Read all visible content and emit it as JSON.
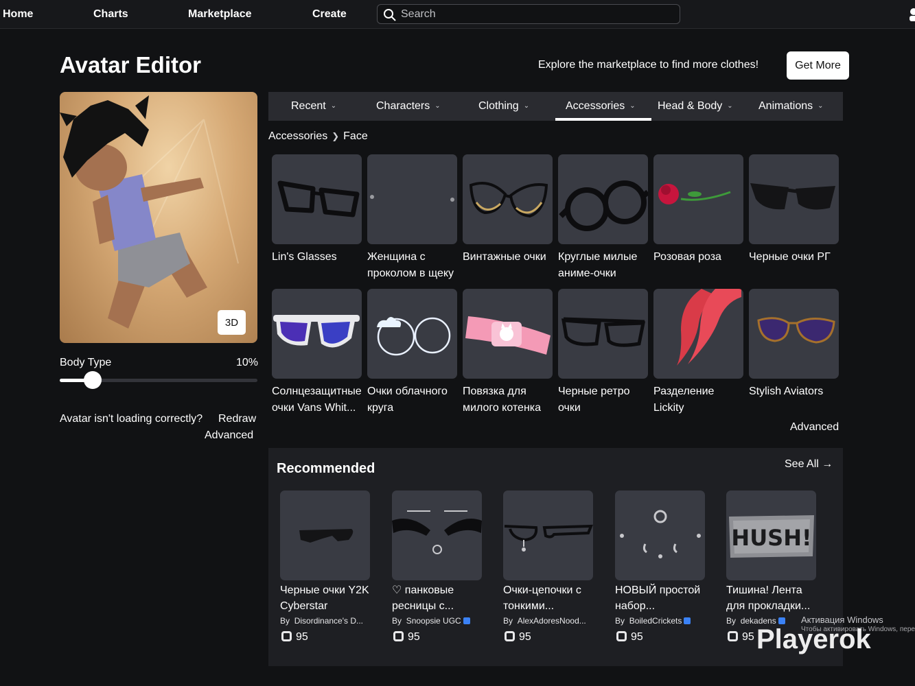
{
  "nav": {
    "home": "Home",
    "charts": "Charts",
    "marketplace": "Marketplace",
    "create": "Create",
    "search_placeholder": "Search"
  },
  "header": {
    "title": "Avatar Editor",
    "explore_text": "Explore the marketplace to find more clothes!",
    "get_more_label": "Get More"
  },
  "avatar": {
    "view_3d_label": "3D",
    "body_type_label": "Body Type",
    "body_type_value": "10%",
    "body_type_fraction": 0.1,
    "loading_text": "Avatar isn't loading correctly?",
    "redraw_label": "Redraw",
    "advanced_label": "Advanced"
  },
  "tabs": [
    {
      "label": "Recent"
    },
    {
      "label": "Characters"
    },
    {
      "label": "Clothing"
    },
    {
      "label": "Accessories",
      "active": true
    },
    {
      "label": "Head & Body"
    },
    {
      "label": "Animations"
    }
  ],
  "breadcrumb": {
    "parent": "Accessories",
    "current": "Face"
  },
  "items": [
    {
      "name": "Lin's Glasses",
      "icon": "black-glasses-icon"
    },
    {
      "name": "Женщина с проколом в щеку",
      "icon": "cheek-piercing-icon"
    },
    {
      "name": "Винтажные очки",
      "icon": "vintage-glasses-icon"
    },
    {
      "name": "Круглые милые аниме-очки",
      "icon": "round-glasses-icon"
    },
    {
      "name": "Розовая роза",
      "icon": "rose-icon"
    },
    {
      "name": "Черные очки РГ",
      "icon": "black-sunglasses-icon"
    },
    {
      "name": "Солнцезащитные очки Vans Whit...",
      "icon": "vans-sunglasses-icon"
    },
    {
      "name": "Очки облачного круга",
      "icon": "cloud-glasses-icon"
    },
    {
      "name": "Повязка для милого котенка",
      "icon": "kitty-bandage-icon"
    },
    {
      "name": "Черные ретро очки",
      "icon": "retro-glasses-icon"
    },
    {
      "name": "Разделение Lickity",
      "icon": "red-tongue-icon"
    },
    {
      "name": "Stylish Aviators",
      "icon": "aviators-icon"
    }
  ],
  "advanced_label": "Advanced",
  "recommended": {
    "title": "Recommended",
    "see_all_label": "See All",
    "items": [
      {
        "name": "Черные очки Y2K Cyberstar",
        "by": "Disordinance's D...",
        "verified": false,
        "price": "95",
        "icon": "y2k-glasses-icon"
      },
      {
        "name": "♡ панковые ресницы с...",
        "by": "Snoopsie UGC",
        "verified": true,
        "price": "95",
        "icon": "punk-lashes-icon"
      },
      {
        "name": "Очки-цепочки с тонкими...",
        "by": "AlexAdoresNood...",
        "verified": false,
        "price": "95",
        "icon": "chain-glasses-icon"
      },
      {
        "name": "НОВЫЙ простой набор...",
        "by": "BoiledCrickets",
        "verified": true,
        "price": "95",
        "icon": "piercing-set-icon"
      },
      {
        "name": "Тишина! Лента для прокладки...",
        "by": "dekadens",
        "verified": true,
        "price": "95",
        "icon": "hush-tape-icon"
      }
    ],
    "by_prefix": "By"
  },
  "overlay": {
    "windows_activation": "Активация Windows",
    "windows_hint": "Чтобы активировать Windows, пере",
    "watermark": "Playerok"
  },
  "colors": {
    "background": "#111214",
    "tile": "#393b43",
    "panel": "#1e1f23",
    "accent": "#ffffff"
  }
}
